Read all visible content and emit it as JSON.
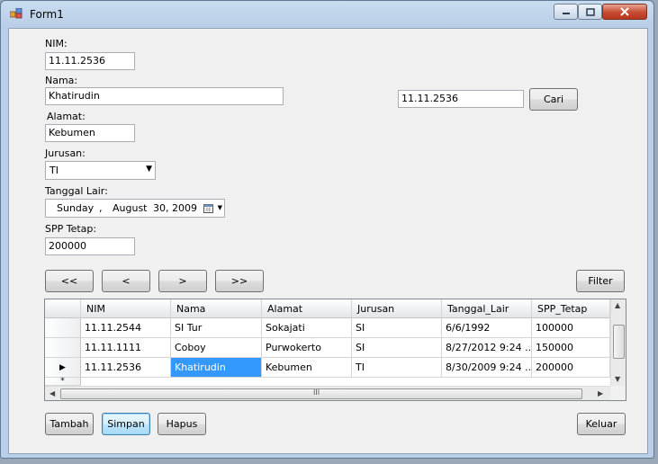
{
  "window": {
    "title": "Form1",
    "minimize": "0",
    "maximize": "1",
    "close": "r"
  },
  "form": {
    "nim_label": "NIM:",
    "nim_value": "11.11.2536",
    "nama_label": "Nama:",
    "nama_value": "Khatirudin",
    "alamat_label": "Alamat:",
    "alamat_value": "Kebumen",
    "jurusan_label": "Jurusan:",
    "jurusan_value": "TI",
    "tanggal_label": "Tanggal Lair:",
    "tanggal_day": "Sunday",
    "tanggal_comma": ",",
    "tanggal_month": "August",
    "tanggal_date": "30, 2009",
    "spp_label": "SPP Tetap:",
    "spp_value": "200000"
  },
  "search": {
    "value": "11.11.2536",
    "button": "Cari"
  },
  "nav": {
    "first": "<<",
    "prev": "<",
    "next": ">",
    "last": ">>",
    "filter": "Filter"
  },
  "grid": {
    "columns": [
      "NIM",
      "Nama",
      "Alamat",
      "Jurusan",
      "Tanggal_Lair",
      "SPP_Tetap"
    ],
    "rows": [
      [
        "11.11.2544",
        "SI Tur",
        "Sokajati",
        "SI",
        "6/6/1992",
        "100000"
      ],
      [
        "11.11.1111",
        "Coboy",
        "Purwokerto",
        "SI",
        "8/27/2012 9:24 ...",
        "150000"
      ],
      [
        "11.11.2536",
        "Khatirudin",
        "Kebumen",
        "TI",
        "8/30/2009 9:24 ...",
        "200000"
      ]
    ],
    "current_row_marker": "▶",
    "new_row_marker": "*",
    "hscroll_grip": "III"
  },
  "actions": {
    "tambah": "Tambah",
    "simpan": "Simpan",
    "hapus": "Hapus",
    "keluar": "Keluar"
  }
}
